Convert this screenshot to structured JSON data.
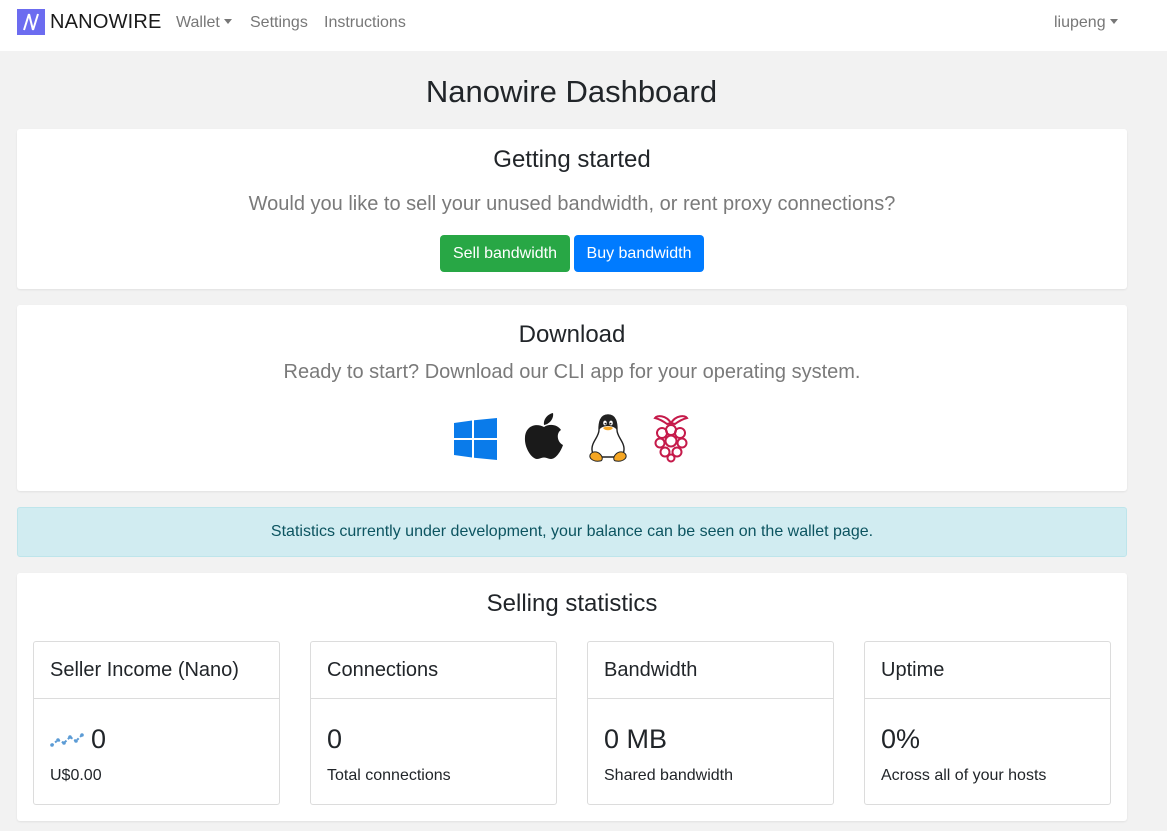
{
  "nav": {
    "brand": "NANOWIRE",
    "items": [
      {
        "label": "Wallet",
        "dropdown": true
      },
      {
        "label": "Settings",
        "dropdown": false
      },
      {
        "label": "Instructions",
        "dropdown": false
      }
    ],
    "user": "liupeng"
  },
  "page": {
    "title": "Nanowire Dashboard"
  },
  "getting_started": {
    "title": "Getting started",
    "subtitle": "Would you like to sell your unused bandwidth, or rent proxy connections?",
    "sell_label": "Sell bandwidth",
    "buy_label": "Buy bandwidth"
  },
  "download": {
    "title": "Download",
    "subtitle": "Ready to start? Download our CLI app for your operating system.",
    "icons": [
      "windows-icon",
      "apple-icon",
      "linux-icon",
      "raspberry-pi-icon"
    ]
  },
  "alert": {
    "text": "Statistics currently under development, your balance can be seen on the wallet page."
  },
  "stats": {
    "title": "Selling statistics",
    "cards": [
      {
        "header": "Seller Income (Nano)",
        "value": "0",
        "label": "U$0.00",
        "icon": "trend-chart-icon"
      },
      {
        "header": "Connections",
        "value": "0",
        "label": "Total connections"
      },
      {
        "header": "Bandwidth",
        "value": "0 MB",
        "label": "Shared bandwidth"
      },
      {
        "header": "Uptime",
        "value": "0%",
        "label": "Across all of your hosts"
      }
    ]
  },
  "colors": {
    "brand": "#6c6cf0",
    "success": "#28a745",
    "primary": "#007bff",
    "info_bg": "#d1ecf1",
    "info_text": "#0c5460",
    "windows": "#0a7bea",
    "apple": "#1a1a1a",
    "raspberry": "#c51a4a"
  }
}
